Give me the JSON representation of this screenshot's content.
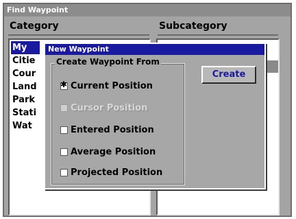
{
  "window": {
    "title": "Find Waypoint"
  },
  "columns": {
    "category": "Category",
    "subcategory": "Subcategory"
  },
  "categories": [
    {
      "label": "My",
      "selected": true
    },
    {
      "label": "Citie",
      "selected": false
    },
    {
      "label": "Cour",
      "selected": false
    },
    {
      "label": "Land",
      "selected": false
    },
    {
      "label": "Park",
      "selected": false
    },
    {
      "label": "Stati",
      "selected": false
    },
    {
      "label": "Wat",
      "selected": false
    }
  ],
  "dialog": {
    "title": "New Waypoint",
    "group_label": "Create Waypoint From",
    "options": [
      {
        "label": "Current Position",
        "checked": true,
        "enabled": true
      },
      {
        "label": "Cursor Position",
        "checked": false,
        "enabled": false
      },
      {
        "label": "Entered Position",
        "checked": false,
        "enabled": true
      },
      {
        "label": "Average Position",
        "checked": false,
        "enabled": true
      },
      {
        "label": "Projected Position",
        "checked": false,
        "enabled": true
      }
    ],
    "create_label": "Create"
  },
  "colors": {
    "selection": "#1a1aa0",
    "window_bg": "#a4a4a4",
    "dialog_bg": "#a7a7a7"
  }
}
